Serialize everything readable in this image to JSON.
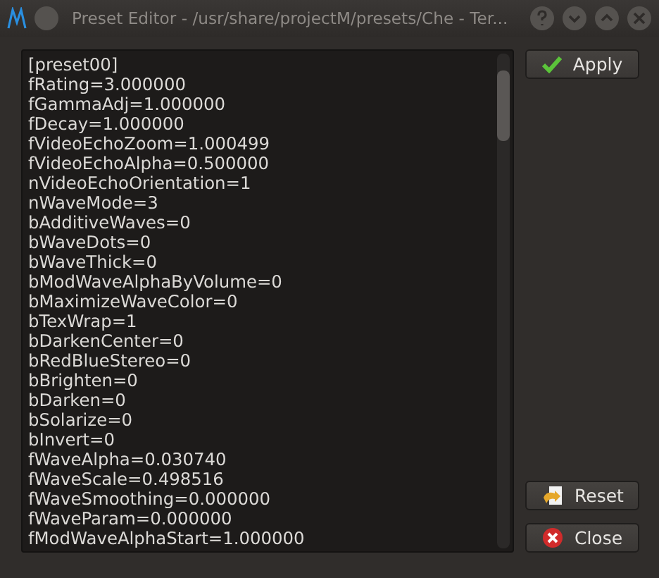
{
  "window": {
    "title": "Preset Editor - /usr/share/projectM/presets/Che - Ter..."
  },
  "editor": {
    "lines": [
      "[preset00]",
      "fRating=3.000000",
      "fGammaAdj=1.000000",
      "fDecay=1.000000",
      "fVideoEchoZoom=1.000499",
      "fVideoEchoAlpha=0.500000",
      "nVideoEchoOrientation=1",
      "nWaveMode=3",
      "bAdditiveWaves=0",
      "bWaveDots=0",
      "bWaveThick=0",
      "bModWaveAlphaByVolume=0",
      "bMaximizeWaveColor=0",
      "bTexWrap=1",
      "bDarkenCenter=0",
      "bRedBlueStereo=0",
      "bBrighten=0",
      "bDarken=0",
      "bSolarize=0",
      "bInvert=0",
      "fWaveAlpha=0.030740",
      "fWaveScale=0.498516",
      "fWaveSmoothing=0.000000",
      "fWaveParam=0.000000",
      "fModWaveAlphaStart=1.000000"
    ]
  },
  "buttons": [
    {
      "kind": "apply",
      "label": "Apply"
    },
    {
      "kind": "reset",
      "label": "Reset"
    },
    {
      "kind": "close",
      "label": "Close"
    }
  ]
}
